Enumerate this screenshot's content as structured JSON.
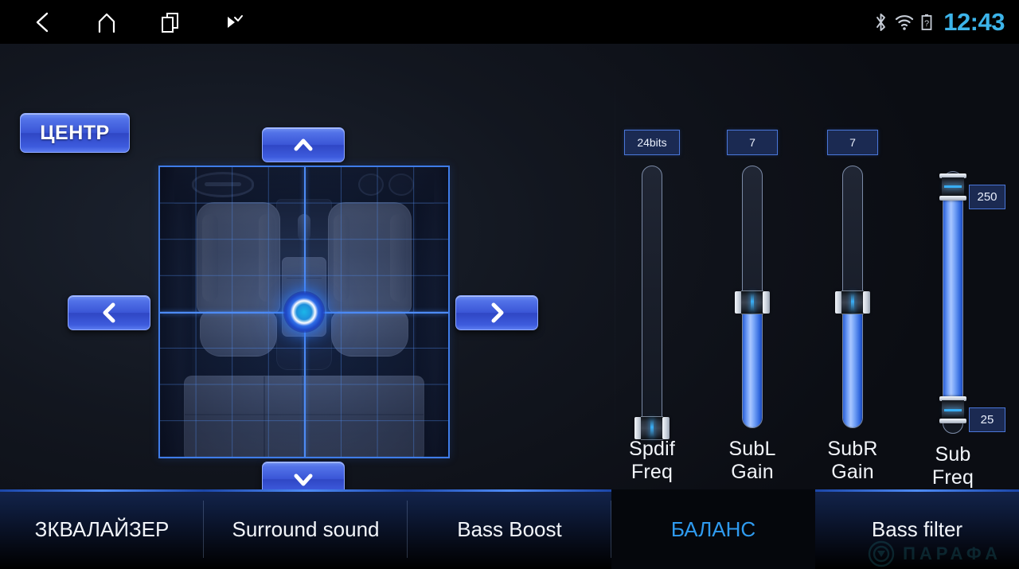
{
  "status_bar": {
    "nav": [
      {
        "name": "back-icon",
        "label": "Back"
      },
      {
        "name": "home-icon",
        "label": "Home"
      },
      {
        "name": "recents-icon",
        "label": "Recent apps"
      },
      {
        "name": "volume-icon",
        "label": "Volume"
      }
    ],
    "indicators": [
      {
        "name": "bluetooth-icon",
        "label": "Bluetooth"
      },
      {
        "name": "wifi-icon",
        "label": "Wi-Fi"
      },
      {
        "name": "battery-unknown-icon",
        "label": "Battery unknown"
      }
    ],
    "time": "12:43",
    "time_color": "#3cb4ea"
  },
  "balance": {
    "preset_button": "ЦЕНТР",
    "arrows": {
      "up": "Up",
      "down": "Down",
      "left": "Left",
      "right": "Right"
    },
    "position_marker": "Listening position"
  },
  "sliders": [
    {
      "id": "spdif-freq",
      "label": "Spdif\nFreq",
      "value": "24bits",
      "fill_percent": 0,
      "thumb_percent": 0,
      "type": "single"
    },
    {
      "id": "subl-gain",
      "label": "SubL\nGain",
      "value": "7",
      "fill_percent": 48,
      "thumb_percent": 48,
      "type": "single"
    },
    {
      "id": "subr-gain",
      "label": "SubR\nGain",
      "value": "7",
      "fill_percent": 48,
      "thumb_percent": 48,
      "type": "single"
    },
    {
      "id": "sub-freq",
      "label": "Sub\nFreq",
      "type": "range",
      "max_value": "250",
      "min_value": "25",
      "max_percent": 94,
      "min_percent": 9
    }
  ],
  "tabs": [
    {
      "id": "equalizer",
      "label": "ЗКВАЛАЙЗЕР",
      "active": false
    },
    {
      "id": "surround-sound",
      "label": "Surround sound",
      "active": false
    },
    {
      "id": "bass-boost",
      "label": "Bass Boost",
      "active": false
    },
    {
      "id": "balance",
      "label": "БАЛАНС",
      "active": true
    },
    {
      "id": "bass-filter",
      "label": "Bass filter",
      "active": false
    }
  ],
  "watermark": {
    "text": "ПАРАФА",
    "color": "#1e6e78"
  },
  "theme": {
    "accent_blue": "#3a55d6",
    "active_tab_blue": "#2f9bf0",
    "slider_fill": "#6f9df6",
    "chip_bg": "#1b2a52",
    "chip_border": "#4a76d8"
  }
}
